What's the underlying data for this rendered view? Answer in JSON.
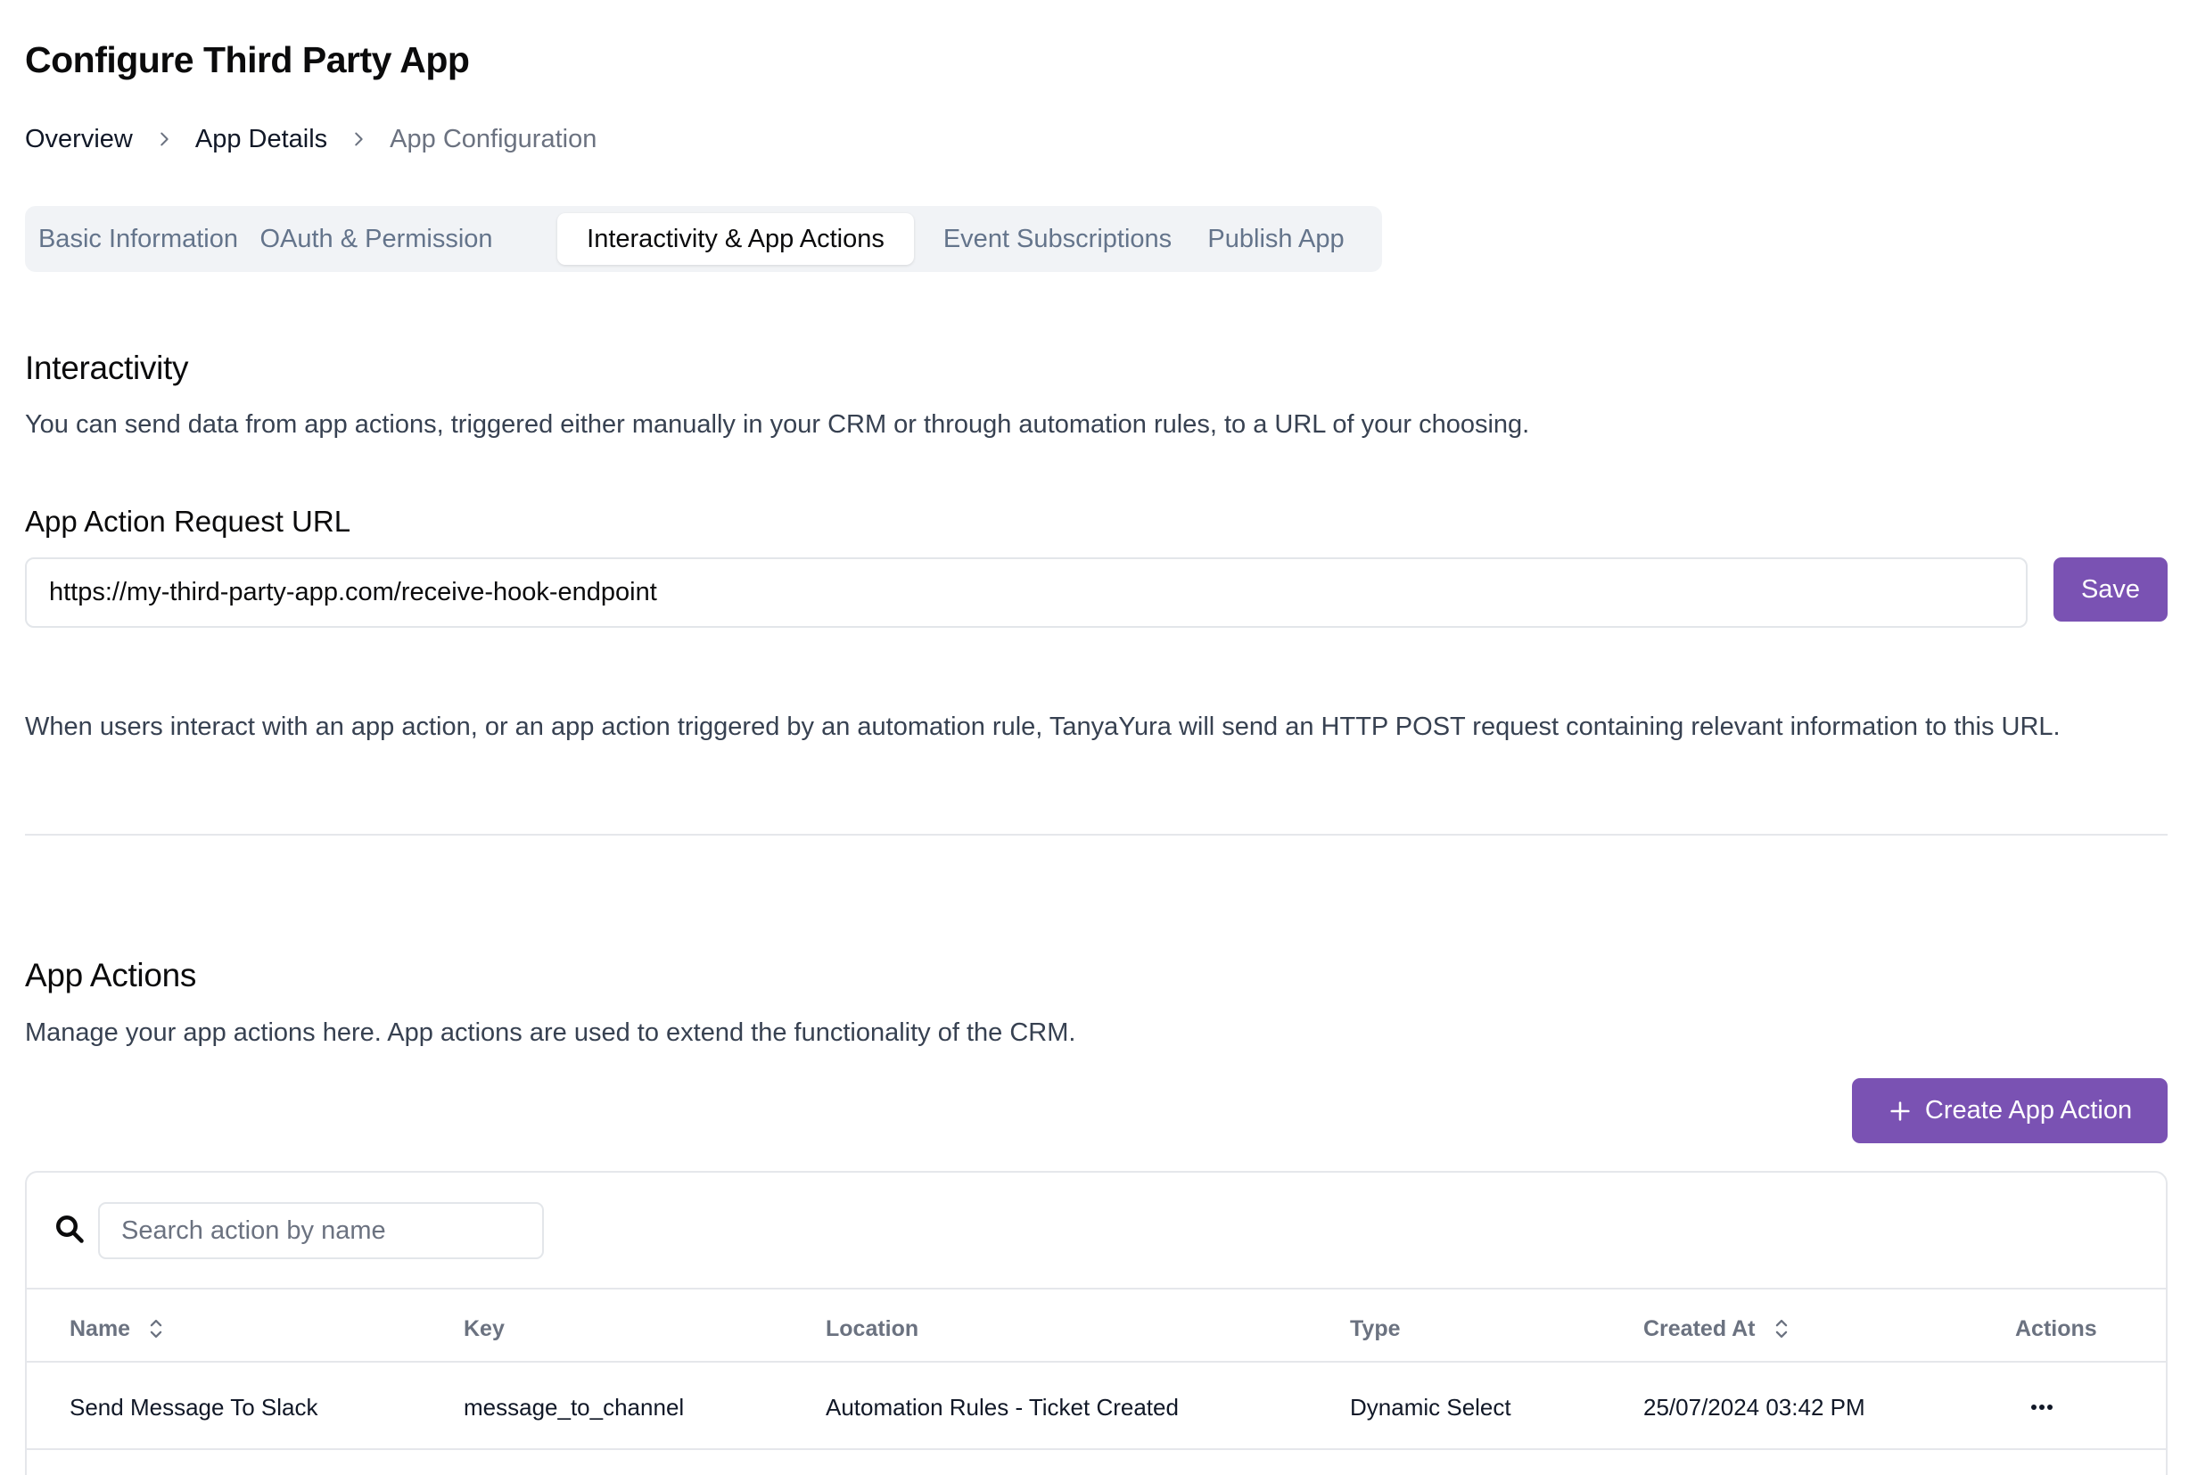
{
  "page": {
    "title": "Configure Third Party App"
  },
  "breadcrumb": {
    "items": [
      "Overview",
      "App Details",
      "App Configuration"
    ]
  },
  "tabs": [
    {
      "label": "Basic Information",
      "active": false
    },
    {
      "label": "OAuth & Permission",
      "active": false
    },
    {
      "label": "Interactivity & App Actions",
      "active": true
    },
    {
      "label": "Event Subscriptions",
      "active": false
    },
    {
      "label": "Publish App",
      "active": false
    }
  ],
  "interactivity": {
    "title": "Interactivity",
    "description": "You can send data from app actions, triggered either manually in your CRM or through automation rules, to a URL of your choosing.",
    "url_label": "App Action Request URL",
    "url_value": "https://my-third-party-app.com/receive-hook-endpoint",
    "save_label": "Save",
    "hint": "When users interact with an app action, or an app action triggered by an automation rule, TanyaYura will send an HTTP POST request containing relevant information to this URL."
  },
  "app_actions": {
    "title": "App Actions",
    "description": "Manage your app actions here. App actions are used to extend the functionality of the CRM.",
    "create_label": "Create App Action",
    "search_placeholder": "Search action by name",
    "columns": [
      "Name",
      "Key",
      "Location",
      "Type",
      "Created At",
      "Actions"
    ],
    "rows": [
      {
        "name": "Send Message To Slack",
        "key": "message_to_channel",
        "location": "Automation Rules - Ticket Created",
        "type": "Dynamic Select",
        "created_at": "25/07/2024 03:42 PM"
      }
    ]
  },
  "theme": {
    "primary": "#7a52b3",
    "muted_text": "#6b7280",
    "border": "#e5e7eb",
    "tab_bg": "#f1f3f6"
  },
  "icons": [
    "chevron-right-icon",
    "plus-icon",
    "search-icon",
    "sort-icon",
    "more-horizontal-icon"
  ]
}
